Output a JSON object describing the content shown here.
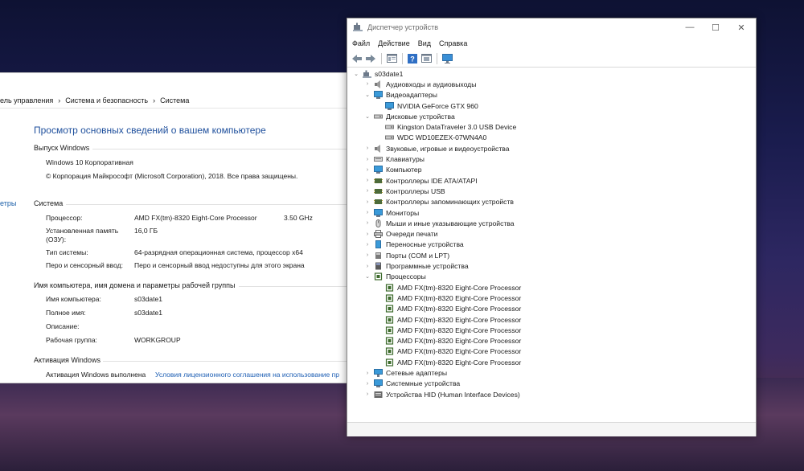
{
  "system_window": {
    "breadcrumb": [
      "ель управления",
      "Система и безопасность",
      "Система"
    ],
    "left_nav_stub": "етры",
    "main_title": "Просмотр основных сведений о вашем компьютере",
    "edition": {
      "heading": "Выпуск Windows",
      "name": "Windows 10 Корпоративная",
      "copyright": "© Корпорация Майкрософт (Microsoft Corporation), 2018. Все права защищены."
    },
    "system": {
      "heading": "Система",
      "processor_label": "Процессор:",
      "processor_value": "AMD FX(tm)-8320 Eight-Core Processor",
      "processor_speed": "3.50 GHz",
      "ram_label_line1": "Установленная память",
      "ram_label_line2": "(ОЗУ):",
      "ram_value": "16,0 ГБ",
      "type_label": "Тип системы:",
      "type_value": "64-разрядная операционная система, процессор x64",
      "pen_label": "Перо и сенсорный ввод:",
      "pen_value": "Перо и сенсорный ввод недоступны для этого экрана"
    },
    "computer_name": {
      "heading": "Имя компьютера, имя домена и параметры рабочей группы",
      "name_label": "Имя компьютера:",
      "name_value": "s03date1",
      "fullname_label": "Полное имя:",
      "fullname_value": "s03date1",
      "desc_label": "Описание:",
      "workgroup_label": "Рабочая группа:",
      "workgroup_value": "WORKGROUP"
    },
    "activation": {
      "heading": "Активация Windows",
      "status": "Активация Windows выполнена",
      "link": "Условия лицензионного соглашения на использование пр"
    }
  },
  "device_manager": {
    "title": "Диспетчер устройств",
    "menu": [
      "Файл",
      "Действие",
      "Вид",
      "Справка"
    ],
    "root": "s03date1",
    "tree": [
      {
        "label": "Аудиовходы и аудиовыходы",
        "level": 1,
        "state": "collapsed",
        "icon": "audio-icon"
      },
      {
        "label": "Видеоадаптеры",
        "level": 1,
        "state": "expanded",
        "icon": "display-adapter-icon"
      },
      {
        "label": "NVIDIA GeForce GTX 960",
        "level": 2,
        "state": "leaf",
        "icon": "display-adapter-icon"
      },
      {
        "label": "Дисковые устройства",
        "level": 1,
        "state": "expanded",
        "icon": "disk-icon"
      },
      {
        "label": "Kingston DataTraveler 3.0 USB Device",
        "level": 2,
        "state": "leaf",
        "icon": "disk-icon"
      },
      {
        "label": "WDC WD10EZEX-07WN4A0",
        "level": 2,
        "state": "leaf",
        "icon": "disk-icon"
      },
      {
        "label": "Звуковые, игровые и видеоустройства",
        "level": 1,
        "state": "collapsed",
        "icon": "speaker-icon"
      },
      {
        "label": "Клавиатуры",
        "level": 1,
        "state": "collapsed",
        "icon": "keyboard-icon"
      },
      {
        "label": "Компьютер",
        "level": 1,
        "state": "collapsed",
        "icon": "computer-icon"
      },
      {
        "label": "Контроллеры IDE ATA/ATAPI",
        "level": 1,
        "state": "collapsed",
        "icon": "controller-icon"
      },
      {
        "label": "Контроллеры USB",
        "level": 1,
        "state": "collapsed",
        "icon": "usb-icon"
      },
      {
        "label": "Контроллеры запоминающих устройств",
        "level": 1,
        "state": "collapsed",
        "icon": "storage-controller-icon"
      },
      {
        "label": "Мониторы",
        "level": 1,
        "state": "collapsed",
        "icon": "monitor-icon"
      },
      {
        "label": "Мыши и иные указывающие устройства",
        "level": 1,
        "state": "collapsed",
        "icon": "mouse-icon"
      },
      {
        "label": "Очереди печати",
        "level": 1,
        "state": "collapsed",
        "icon": "printer-icon"
      },
      {
        "label": "Переносные устройства",
        "level": 1,
        "state": "collapsed",
        "icon": "portable-device-icon"
      },
      {
        "label": "Порты (COM и LPT)",
        "level": 1,
        "state": "collapsed",
        "icon": "port-icon"
      },
      {
        "label": "Программные устройства",
        "level": 1,
        "state": "collapsed",
        "icon": "software-device-icon"
      },
      {
        "label": "Процессоры",
        "level": 1,
        "state": "expanded",
        "icon": "processor-icon"
      },
      {
        "label": "AMD FX(tm)-8320 Eight-Core Processor",
        "level": 2,
        "state": "leaf",
        "icon": "processor-icon"
      },
      {
        "label": "AMD FX(tm)-8320 Eight-Core Processor",
        "level": 2,
        "state": "leaf",
        "icon": "processor-icon"
      },
      {
        "label": "AMD FX(tm)-8320 Eight-Core Processor",
        "level": 2,
        "state": "leaf",
        "icon": "processor-icon"
      },
      {
        "label": "AMD FX(tm)-8320 Eight-Core Processor",
        "level": 2,
        "state": "leaf",
        "icon": "processor-icon"
      },
      {
        "label": "AMD FX(tm)-8320 Eight-Core Processor",
        "level": 2,
        "state": "leaf",
        "icon": "processor-icon"
      },
      {
        "label": "AMD FX(tm)-8320 Eight-Core Processor",
        "level": 2,
        "state": "leaf",
        "icon": "processor-icon"
      },
      {
        "label": "AMD FX(tm)-8320 Eight-Core Processor",
        "level": 2,
        "state": "leaf",
        "icon": "processor-icon"
      },
      {
        "label": "AMD FX(tm)-8320 Eight-Core Processor",
        "level": 2,
        "state": "leaf",
        "icon": "processor-icon"
      },
      {
        "label": "Сетевые адаптеры",
        "level": 1,
        "state": "collapsed",
        "icon": "network-adapter-icon"
      },
      {
        "label": "Системные устройства",
        "level": 1,
        "state": "collapsed",
        "icon": "system-device-icon"
      },
      {
        "label": "Устройства HID (Human Interface Devices)",
        "level": 1,
        "state": "collapsed",
        "icon": "hid-icon"
      }
    ]
  }
}
